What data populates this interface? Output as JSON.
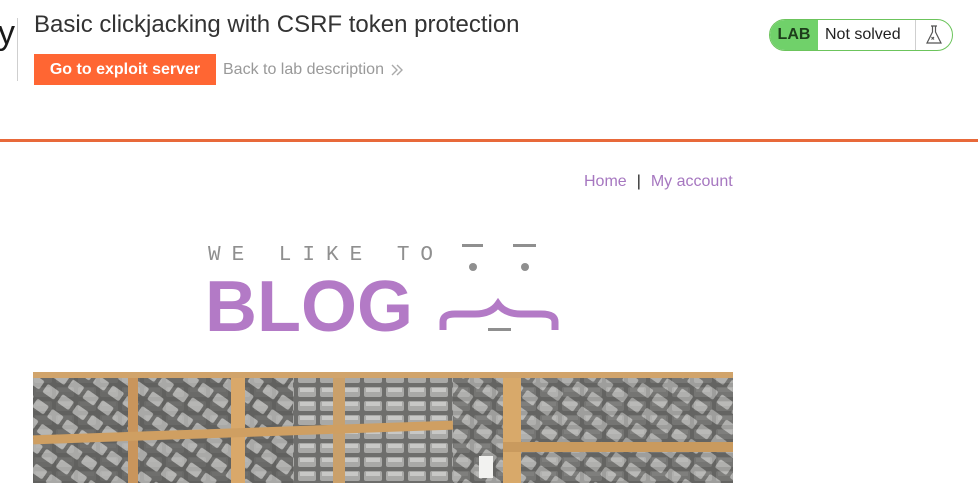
{
  "header": {
    "title": "Basic clickjacking with CSRF token protection",
    "exploit_button": "Go to exploit server",
    "back_link": "Back to lab description"
  },
  "lab": {
    "badge": "LAB",
    "status": "Not solved"
  },
  "nav": {
    "home": "Home",
    "separator": "|",
    "my_account": "My account"
  },
  "blog_logo": {
    "tagline": "WE LIKE TO",
    "word": "BLOG"
  },
  "colors": {
    "accent_orange": "#ff6633",
    "link_purple": "#a677c0",
    "lab_green": "#70d16a",
    "blog_purple": "#b37ac6"
  },
  "icons": [
    "chevron-double-right-icon",
    "flask-icon"
  ]
}
